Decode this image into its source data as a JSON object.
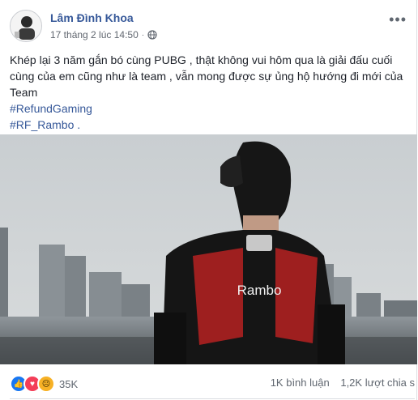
{
  "post": {
    "author": "Lâm Đình Khoa",
    "timestamp": "17 tháng 2 lúc 14:50",
    "privacy_icon": "globe-icon",
    "more_icon": "more-options-icon",
    "body": "Khép lại 3 năm gắn bó cùng PUBG , thật không vui hôm qua là giải đấu cuối cùng của em cũng như là team , vẫn mong được sự ủng hộ hướng đi mới của Team",
    "hashtags": [
      "#RefundGaming",
      "#RF_Rambo ."
    ],
    "photo": {
      "jersey_name": "Rambo"
    }
  },
  "footer": {
    "reactions": [
      "like-icon",
      "love-icon",
      "sad-icon"
    ],
    "reaction_count": "35K",
    "comments": "1K bình luận",
    "shares": "1,2K lượt chia s"
  },
  "colors": {
    "link": "#365899",
    "text": "#1d2129",
    "muted": "#616770",
    "jersey_red": "#9e1f1f",
    "sky": "#cfd3d6"
  }
}
